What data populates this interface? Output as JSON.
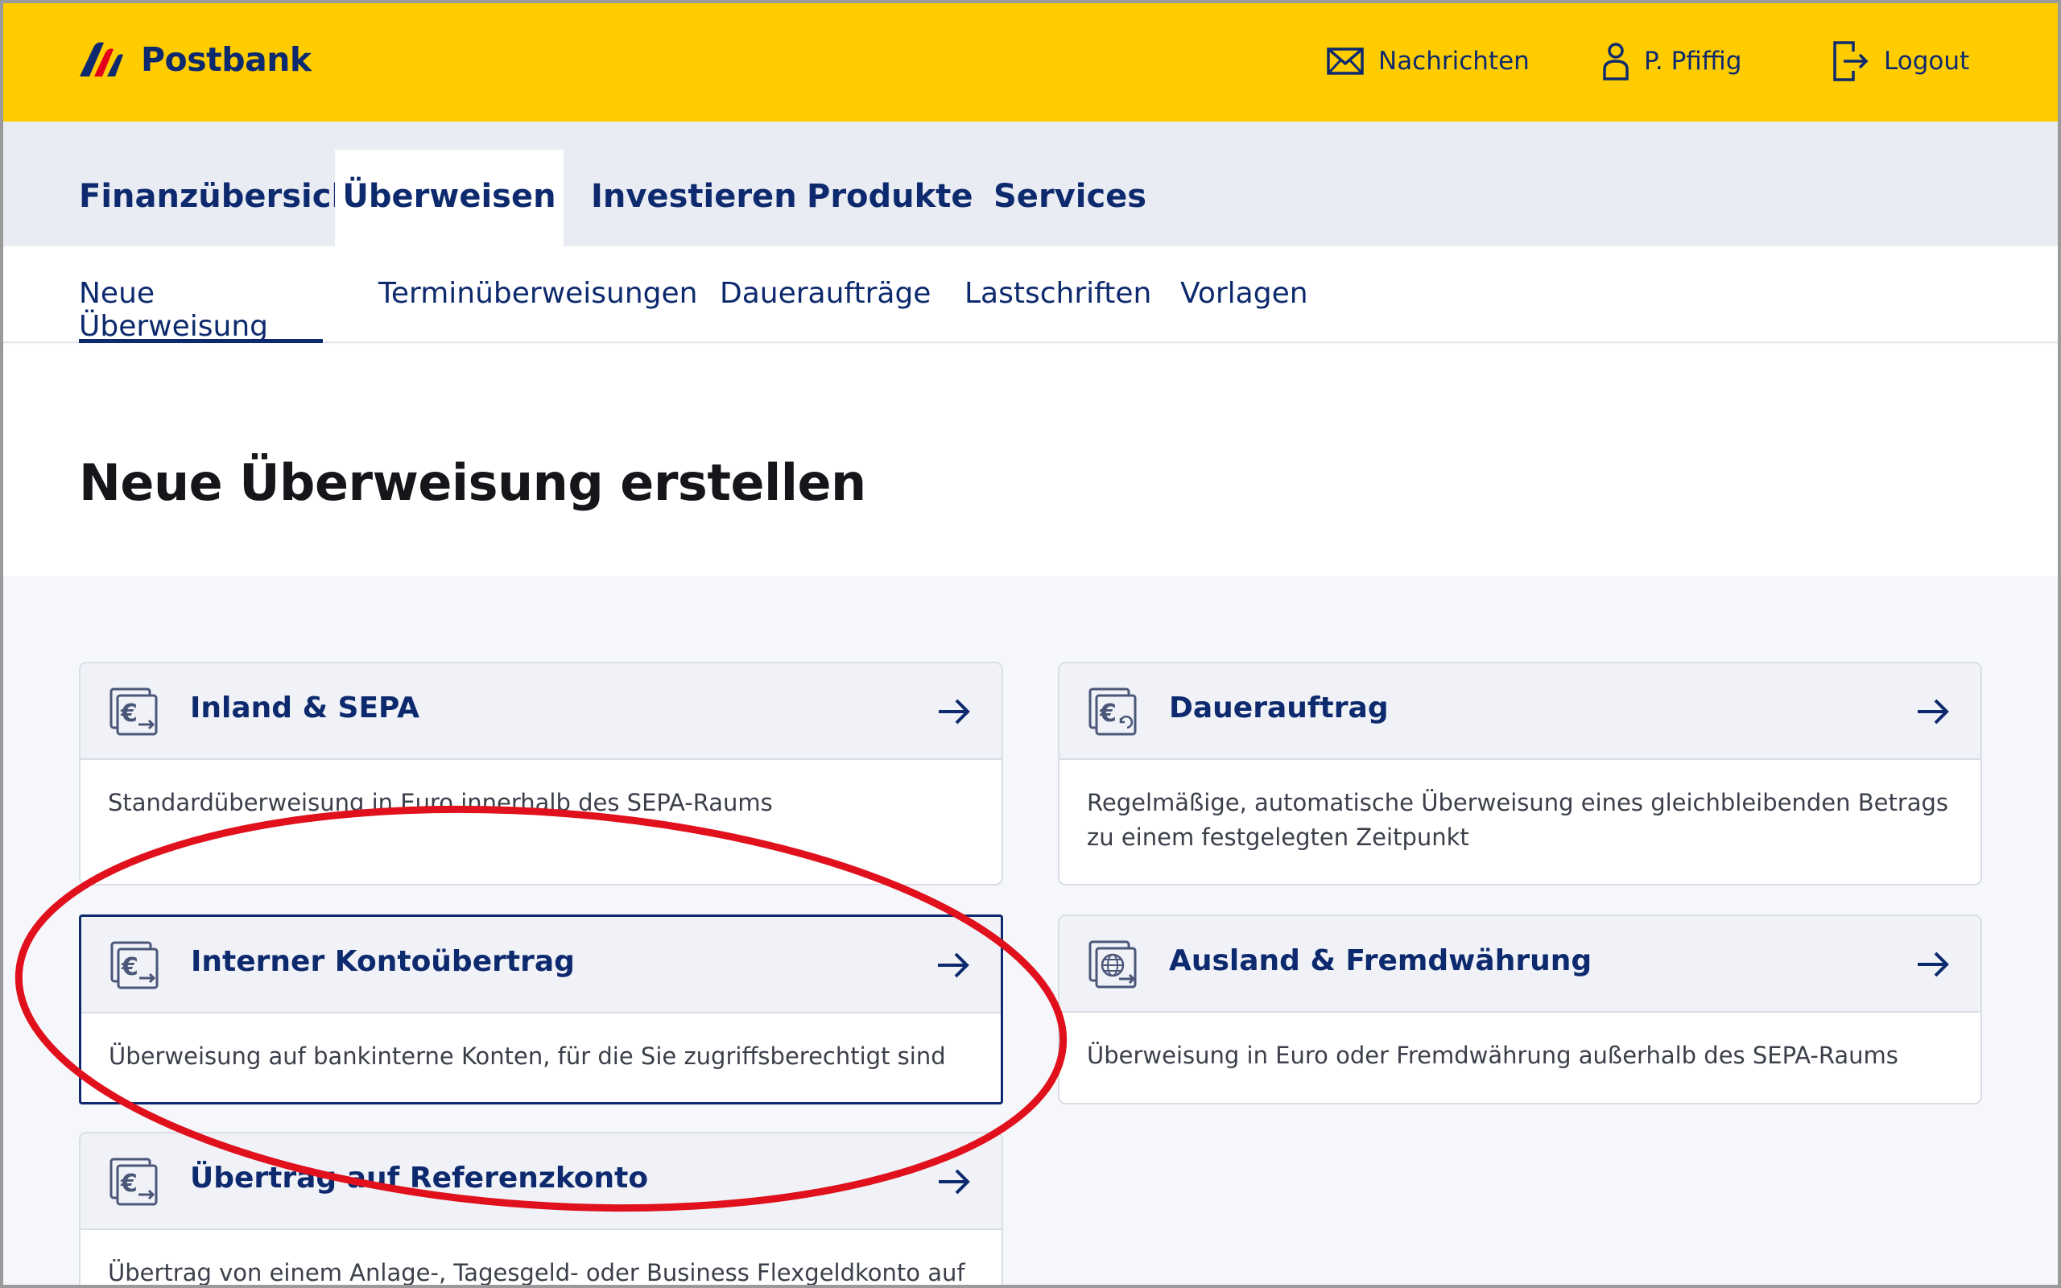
{
  "header": {
    "logo_text": "Postbank",
    "messages_label": "Nachrichten",
    "user_label": "P. Pfiffig",
    "logout_label": "Logout",
    "background_color": "#ffcc00"
  },
  "main_nav": {
    "items": [
      {
        "label": "Finanzübersicht"
      },
      {
        "label": "Überweisen",
        "active": true
      },
      {
        "label": "Investieren"
      },
      {
        "label": "Produkte"
      },
      {
        "label": "Services"
      }
    ]
  },
  "sub_nav": {
    "items": [
      {
        "label": "Neue Überweisung",
        "active": true
      },
      {
        "label": "Terminüberweisungen"
      },
      {
        "label": "Daueraufträge"
      },
      {
        "label": "Lastschriften"
      },
      {
        "label": "Vorlagen"
      }
    ]
  },
  "page": {
    "title": "Neue Überweisung erstellen"
  },
  "cards": [
    {
      "title": "Inland & SEPA",
      "description": "Standardüberweisung in Euro innerhalb des SEPA-Raums",
      "icon": "euro-transfer-icon"
    },
    {
      "title": "Dauerauftrag",
      "description": "Regelmäßige, automatische Überweisung eines gleichbleibenden Betrags zu einem festgelegten Zeitpunkt",
      "icon": "euro-recurring-icon"
    },
    {
      "title": "Interner Kontoübertrag",
      "description": "Überweisung auf bankinterne Konten, für die Sie zugriffsberechtigt sind",
      "icon": "euro-internal-icon",
      "selected": true
    },
    {
      "title": "Ausland & Fremdwährung",
      "description": "Überweisung in Euro oder Fremdwährung außerhalb des SEPA-Raums",
      "icon": "globe-transfer-icon"
    },
    {
      "title": "Übertrag auf Referenzkonto",
      "description": "Übertrag von einem Anlage-, Tagesgeld- oder Business Flexgeldkonto auf",
      "icon": "euro-reference-icon"
    }
  ],
  "colors": {
    "brand_yellow": "#ffcc00",
    "brand_blue": "#0e2a6e",
    "annotation_red": "#e0101c"
  }
}
